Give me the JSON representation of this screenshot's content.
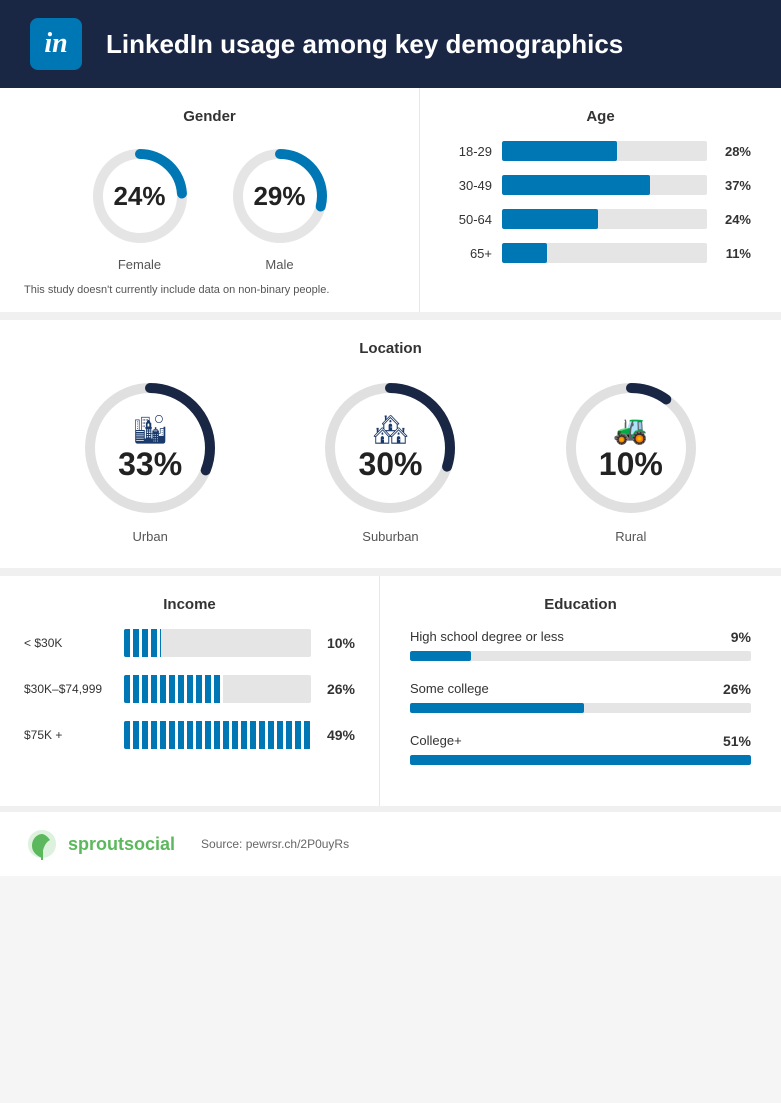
{
  "header": {
    "title": "LinkedIn usage among key demographics",
    "logo_text": "in"
  },
  "gender": {
    "section_title": "Gender",
    "female_pct": "24%",
    "female_label": "Female",
    "male_pct": "29%",
    "male_label": "Male",
    "note": "This study doesn't currently include data on non-binary people.",
    "female_value": 24,
    "male_value": 29
  },
  "age": {
    "section_title": "Age",
    "bars": [
      {
        "label": "18-29",
        "pct": "28%",
        "value": 28
      },
      {
        "label": "30-49",
        "pct": "37%",
        "value": 37
      },
      {
        "label": "50-64",
        "pct": "24%",
        "value": 24
      },
      {
        "label": "65+",
        "pct": "11%",
        "value": 11
      }
    ]
  },
  "location": {
    "section_title": "Location",
    "items": [
      {
        "label": "Urban",
        "pct": "33%",
        "value": 33,
        "icon": "🏙"
      },
      {
        "label": "Suburban",
        "pct": "30%",
        "value": 30,
        "icon": "🏘"
      },
      {
        "label": "Rural",
        "pct": "10%",
        "value": 10,
        "icon": "🚜"
      }
    ]
  },
  "income": {
    "section_title": "Income",
    "bars": [
      {
        "label": "< $30K",
        "pct": "10%",
        "value": 10
      },
      {
        "label": "$30K–$74,999",
        "pct": "26%",
        "value": 26
      },
      {
        "label": "$75K +",
        "pct": "49%",
        "value": 49
      }
    ]
  },
  "education": {
    "section_title": "Education",
    "bars": [
      {
        "label": "High school degree or less",
        "pct": "9%",
        "value": 9
      },
      {
        "label": "Some college",
        "pct": "26%",
        "value": 26
      },
      {
        "label": "College+",
        "pct": "51%",
        "value": 51
      }
    ]
  },
  "footer": {
    "brand": "sprout",
    "brand2": "social",
    "source": "Source: pewrsr.ch/2P0uyRs"
  },
  "colors": {
    "blue": "#0077b5",
    "dark_navy": "#1a2744",
    "green": "#5cb85c"
  }
}
